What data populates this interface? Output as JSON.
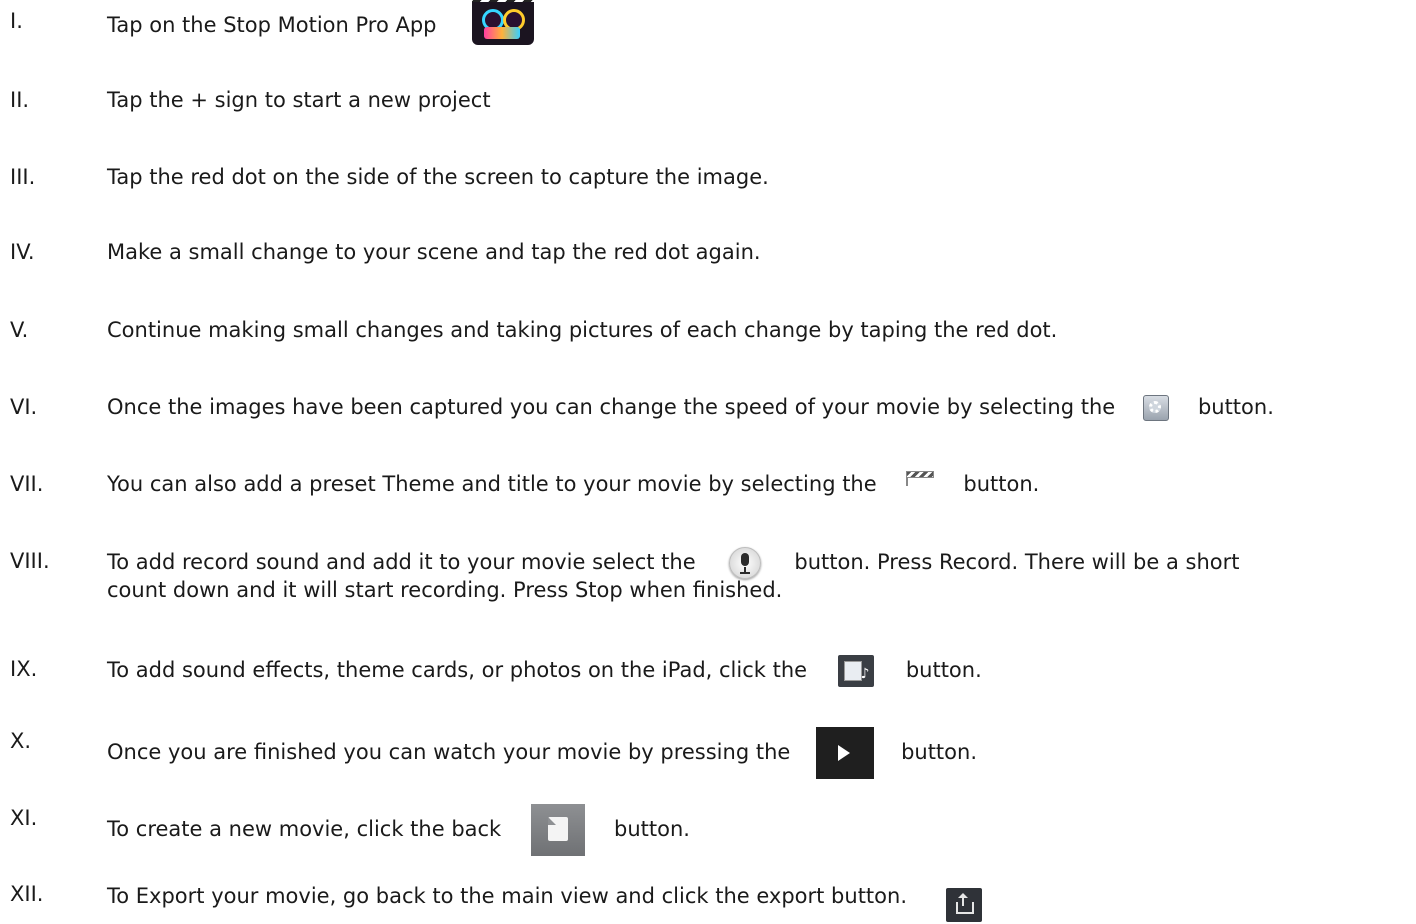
{
  "steps": [
    {
      "num": "I.",
      "text": "Tap on the Stop Motion Pro App"
    },
    {
      "num": "II.",
      "text": "Tap the + sign to start a new project"
    },
    {
      "num": "III.",
      "text": "Tap the red dot on the side of the screen to capture the image."
    },
    {
      "num": "IV.",
      "text": "Make a small change to your scene and tap the red dot again."
    },
    {
      "num": "V.",
      "text": "Continue making small changes and taking pictures of each change by taping the red dot."
    },
    {
      "num": "VI.",
      "before": "Once the images have been captured you can change the speed of your movie by selecting the",
      "after": "button.",
      "icon": "settings-icon"
    },
    {
      "num": "VII.",
      "before": "You can also add a preset Theme and title to your movie by selecting the",
      "after": "button.",
      "icon": "clapperboard-icon"
    },
    {
      "num": "VIII.",
      "before": "To add record sound and add it to your movie select the",
      "after": "button. Press Record. There will be a short",
      "line2": "count down and it will start recording. Press Stop when finished.",
      "icon": "microphone-icon"
    },
    {
      "num": "IX.",
      "before": "To add sound effects, theme cards, or photos on the iPad, click the",
      "after": "button.",
      "icon": "media-library-icon"
    },
    {
      "num": "X.",
      "before": "Once you are finished you can watch your movie by pressing the",
      "after": "button.",
      "icon": "play-icon"
    },
    {
      "num": "XI.",
      "before": "To create a new movie, click the back",
      "after": "button.",
      "icon": "back-page-icon"
    },
    {
      "num": "XII.",
      "text": "To Export your movie, go back to the main view and click the export button.",
      "icon": "export-icon"
    }
  ]
}
